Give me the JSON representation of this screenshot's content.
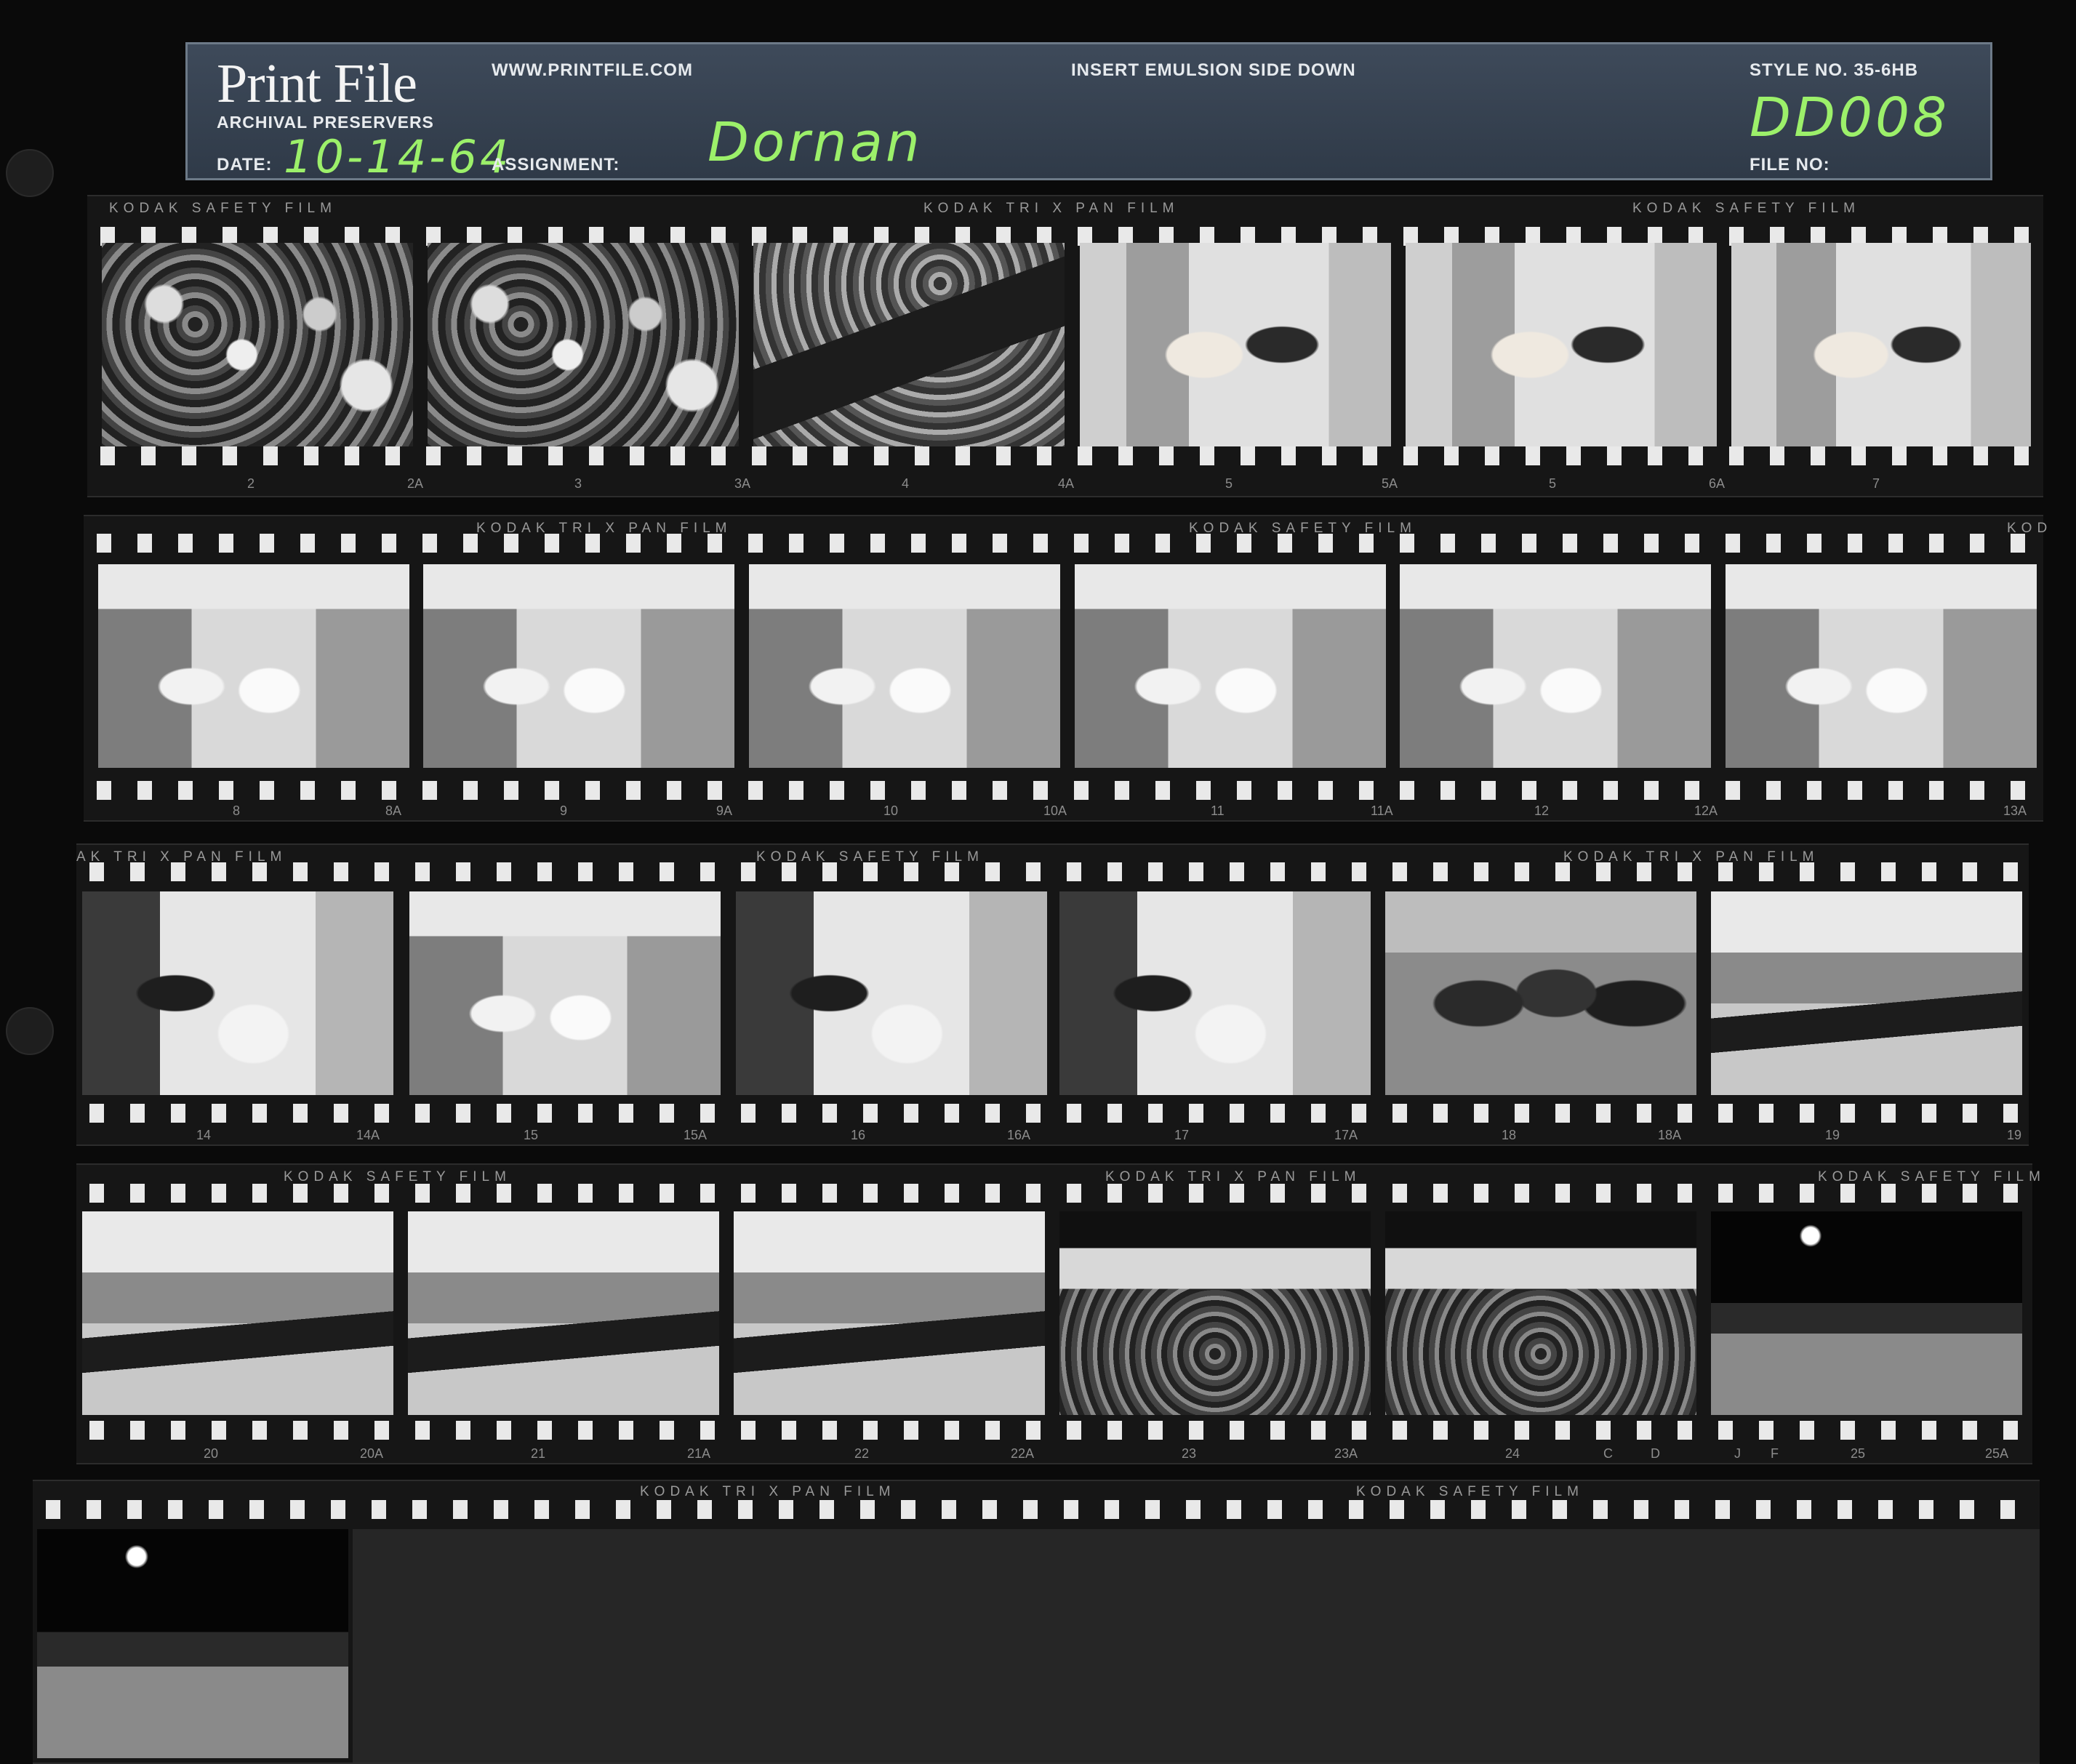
{
  "header": {
    "logo": "Print File",
    "logo_sub": "ARCHIVAL PRESERVERS",
    "website": "WWW.PRINTFILE.COM",
    "instruction": "INSERT EMULSION SIDE DOWN",
    "style_no": "STYLE NO. 35-6HB",
    "date_label": "DATE:",
    "date_value": "10-14-64",
    "assignment_label": "ASSIGNMENT:",
    "assignment_value": "Dornan",
    "file_label": "FILE NO:",
    "file_value": "DD008"
  },
  "film_edge": {
    "kodak_safety": "KODAK  SAFETY  FILM",
    "kodak_trix": "KODAK TRI X PAN FILM",
    "kodak_partial": "KOD",
    "kodak_trix_partial": "AK TRI X PAN FILM"
  },
  "strips": [
    {
      "numbers": [
        "2",
        "2A",
        "3",
        "3A",
        "4",
        "4A",
        "5",
        "5A",
        "5",
        "6A",
        "7"
      ]
    },
    {
      "numbers": [
        "8",
        "8A",
        "9",
        "9A",
        "10",
        "10A",
        "11",
        "11A",
        "12",
        "12A",
        "13A"
      ]
    },
    {
      "numbers": [
        "14",
        "14A",
        "15",
        "15A",
        "16",
        "16A",
        "17",
        "17A",
        "18",
        "18A",
        "19",
        "19"
      ]
    },
    {
      "numbers": [
        "20",
        "20A",
        "21",
        "21A",
        "22",
        "22A",
        "23",
        "23A",
        "24",
        "C",
        "D",
        "J",
        "F",
        "25",
        "25A"
      ]
    },
    {
      "numbers": []
    }
  ]
}
